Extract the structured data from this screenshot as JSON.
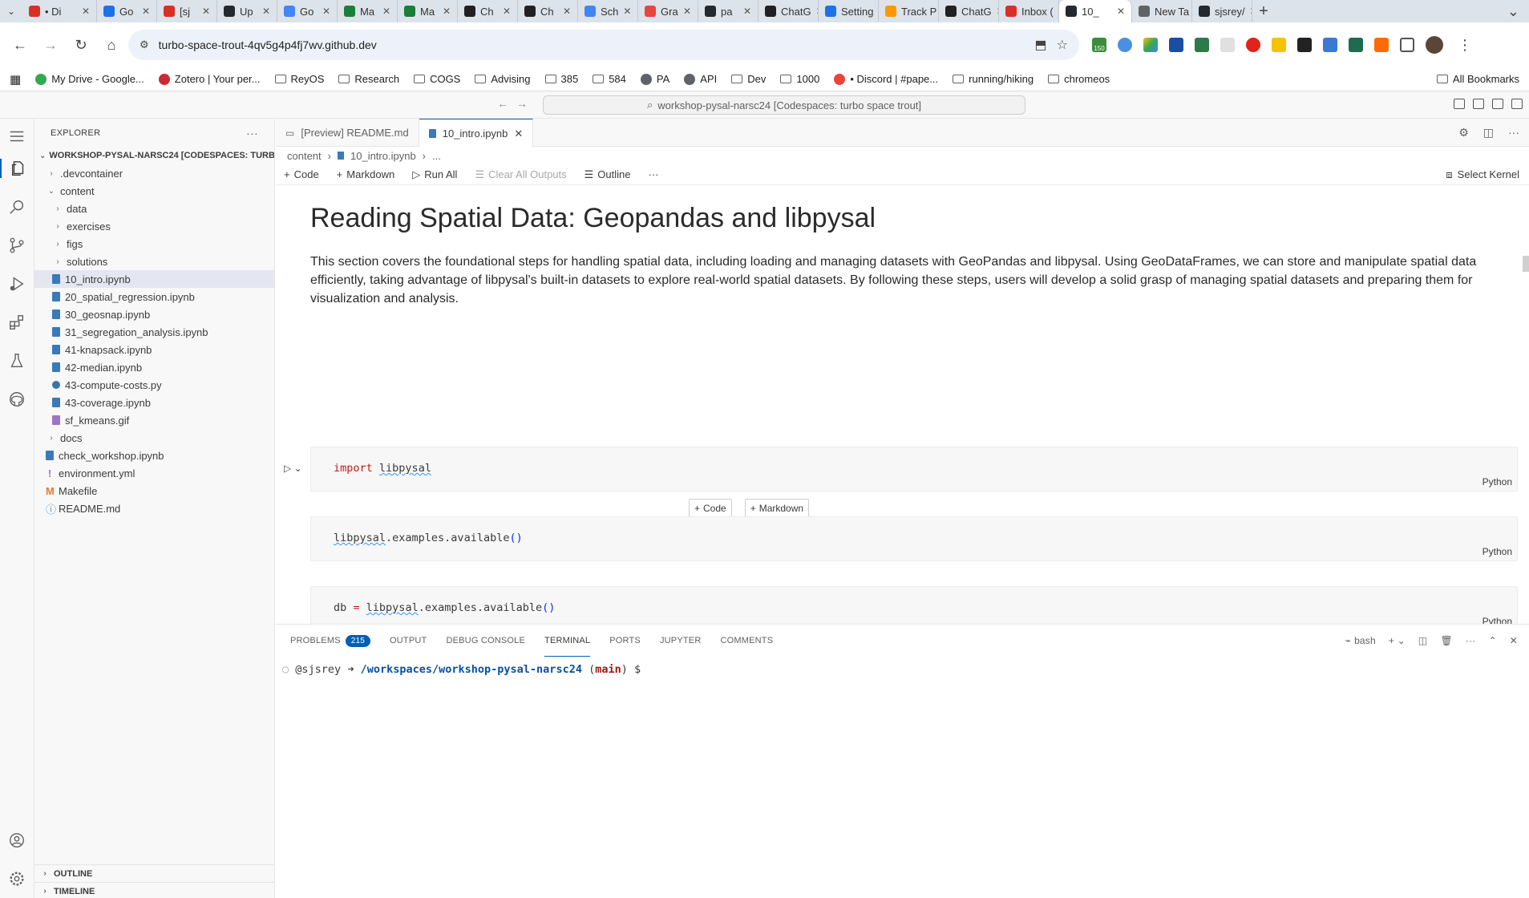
{
  "browser": {
    "tabs": [
      {
        "label": "• Di",
        "color": "#d93025"
      },
      {
        "label": "Go",
        "color": "#1a73e8"
      },
      {
        "label": "[sj",
        "color": "#d93025"
      },
      {
        "label": "Up",
        "color": "#24292f"
      },
      {
        "label": "Go",
        "color": "#4285f4"
      },
      {
        "label": "Ma",
        "color": "#188038"
      },
      {
        "label": "Ma",
        "color": "#188038"
      },
      {
        "label": "Ch",
        "color": "#202124"
      },
      {
        "label": "Ch",
        "color": "#202124"
      },
      {
        "label": "Sch",
        "color": "#4285f4"
      },
      {
        "label": "Gra",
        "color": "#e8453c"
      },
      {
        "label": "pa",
        "color": "#24292f"
      },
      {
        "label": "ChatG",
        "color": "#202124"
      },
      {
        "label": "Setting",
        "color": "#1a73e8"
      },
      {
        "label": "Track P",
        "color": "#ff9900"
      },
      {
        "label": "ChatG",
        "color": "#202124"
      },
      {
        "label": "Inbox (",
        "color": "#d93025"
      },
      {
        "label": "10_",
        "color": "#24292f",
        "active": true
      },
      {
        "label": "New Ta",
        "color": "#5f6368"
      },
      {
        "label": "sjsrey/",
        "color": "#24292f"
      }
    ],
    "url": "turbo-space-trout-4qv5g4p4fj7wv.github.dev",
    "bookmarks": [
      {
        "label": "My Drive - Google...",
        "icon": "drive-icon"
      },
      {
        "label": "Zotero | Your per...",
        "icon": "zotero-icon"
      },
      {
        "label": "ReyOS",
        "icon": "folder-icon"
      },
      {
        "label": "Research",
        "icon": "folder-icon"
      },
      {
        "label": "COGS",
        "icon": "folder-icon"
      },
      {
        "label": "Advising",
        "icon": "folder-icon"
      },
      {
        "label": "385",
        "icon": "folder-icon"
      },
      {
        "label": "584",
        "icon": "folder-icon"
      },
      {
        "label": "PA",
        "icon": "openai-icon"
      },
      {
        "label": "API",
        "icon": "openai-icon"
      },
      {
        "label": "Dev",
        "icon": "folder-icon"
      },
      {
        "label": "1000",
        "icon": "folder-icon"
      },
      {
        "label": "• Discord | #pape...",
        "icon": "discord-icon"
      },
      {
        "label": "running/hiking",
        "icon": "folder-icon"
      },
      {
        "label": "chromeos",
        "icon": "folder-icon"
      }
    ],
    "all_bookmarks": "All Bookmarks",
    "ext_badge": "150"
  },
  "vscode": {
    "command_center": "workshop-pysal-narsc24 [Codespaces: turbo space trout]",
    "explorer_title": "EXPLORER",
    "workspace_title": "WORKSHOP-PYSAL-NARSC24 [CODESPACES: TURB...",
    "tree": [
      {
        "label": ".devcontainer",
        "depth": 1,
        "kind": "folder",
        "open": false
      },
      {
        "label": "content",
        "depth": 1,
        "kind": "folder",
        "open": true
      },
      {
        "label": "data",
        "depth": 2,
        "kind": "folder",
        "open": false
      },
      {
        "label": "exercises",
        "depth": 2,
        "kind": "folder",
        "open": false
      },
      {
        "label": "figs",
        "depth": 2,
        "kind": "folder",
        "open": false
      },
      {
        "label": "solutions",
        "depth": 2,
        "kind": "folder",
        "open": false
      },
      {
        "label": "10_intro.ipynb",
        "depth": 2,
        "kind": "nb",
        "selected": true
      },
      {
        "label": "20_spatial_regression.ipynb",
        "depth": 2,
        "kind": "nb"
      },
      {
        "label": "30_geosnap.ipynb",
        "depth": 2,
        "kind": "nb"
      },
      {
        "label": "31_segregation_analysis.ipynb",
        "depth": 2,
        "kind": "nb"
      },
      {
        "label": "41-knapsack.ipynb",
        "depth": 2,
        "kind": "nb"
      },
      {
        "label": "42-median.ipynb",
        "depth": 2,
        "kind": "nb"
      },
      {
        "label": "43-compute-costs.py",
        "depth": 2,
        "kind": "py"
      },
      {
        "label": "43-coverage.ipynb",
        "depth": 2,
        "kind": "nb"
      },
      {
        "label": "sf_kmeans.gif",
        "depth": 2,
        "kind": "gif"
      },
      {
        "label": "docs",
        "depth": 1,
        "kind": "folder",
        "open": false
      },
      {
        "label": "check_workshop.ipynb",
        "depth": 1,
        "kind": "nb"
      },
      {
        "label": "environment.yml",
        "depth": 1,
        "kind": "yml"
      },
      {
        "label": "Makefile",
        "depth": 1,
        "kind": "make"
      },
      {
        "label": "README.md",
        "depth": 1,
        "kind": "info"
      }
    ],
    "outline_label": "OUTLINE",
    "timeline_label": "TIMELINE",
    "editor_tabs": [
      {
        "label": "[Preview] README.md",
        "active": false
      },
      {
        "label": "10_intro.ipynb",
        "active": true
      }
    ],
    "breadcrumb": [
      "content",
      "10_intro.ipynb",
      "..."
    ],
    "toolbar": {
      "code": "Code",
      "markdown": "Markdown",
      "run_all": "Run All",
      "clear_outputs": "Clear All Outputs",
      "outline": "Outline",
      "more": "···",
      "select_kernel": "Select Kernel"
    },
    "notebook": {
      "title": "Reading Spatial Data: Geopandas and libpysal",
      "paragraph": "This section covers the foundational steps for handling spatial data, including loading and managing datasets with GeoPandas and libpysal. Using GeoDataFrames, we can store and manipulate spatial data efficiently, taking advantage of libpysal's built-in datasets to explore real-world spatial datasets. By following these steps, users will develop a solid grasp of managing spatial datasets and preparing them for visualization and analysis.",
      "cell_lang": "Python",
      "insert_code": "Code",
      "insert_markdown": "Markdown"
    },
    "panel": {
      "tabs": [
        "PROBLEMS",
        "OUTPUT",
        "DEBUG CONSOLE",
        "TERMINAL",
        "PORTS",
        "JUPYTER",
        "COMMENTS"
      ],
      "problems_count": "215",
      "shell": "bash",
      "prompt_user": "@sjsrey",
      "prompt_arrow": "➜",
      "prompt_path": "/workspaces/workshop-pysal-narsc24",
      "prompt_branch": "main",
      "prompt_dollar": "$"
    }
  }
}
